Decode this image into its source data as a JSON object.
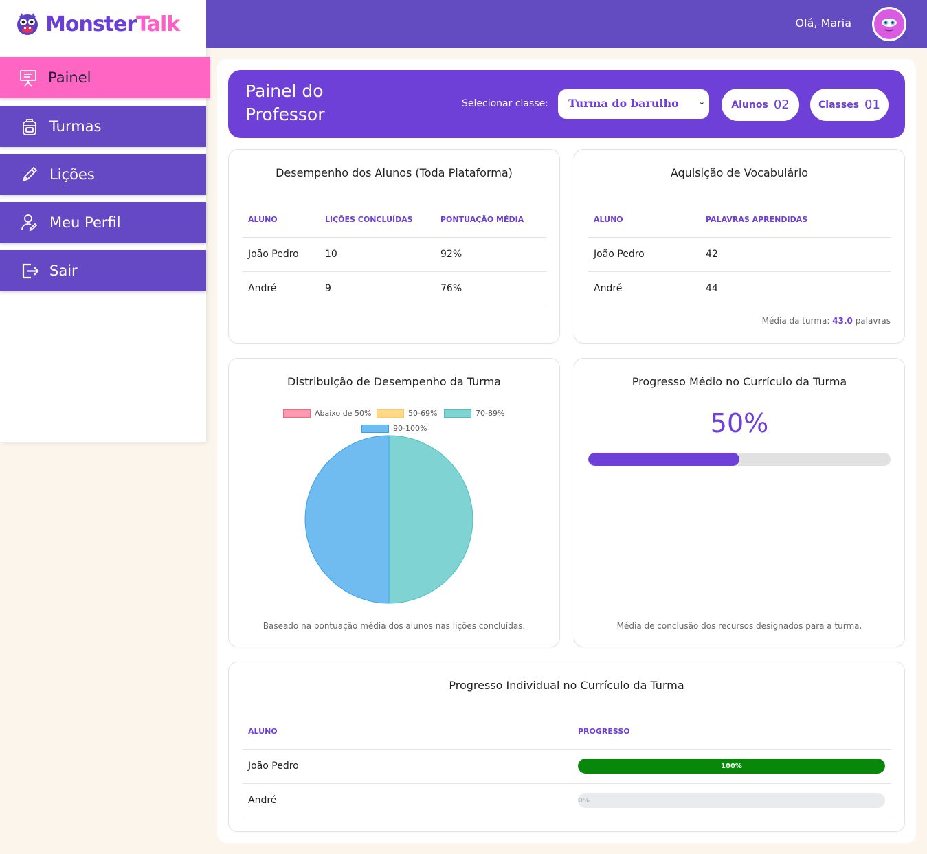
{
  "brand": {
    "part1": "Monster",
    "part2": "Talk"
  },
  "sidebar": {
    "items": [
      {
        "label": "Painel",
        "icon": "presentation-icon",
        "active": true
      },
      {
        "label": "Turmas",
        "icon": "backpack-icon",
        "active": false
      },
      {
        "label": "Lições",
        "icon": "pencil-icon",
        "active": false
      },
      {
        "label": "Meu Perfil",
        "icon": "user-edit-icon",
        "active": false
      },
      {
        "label": "Sair",
        "icon": "logout-icon",
        "active": false
      }
    ]
  },
  "topbar": {
    "greeting": "Olá, Maria",
    "avatar_icon": "monster-avatar-icon"
  },
  "header": {
    "title": "Painel do Professor",
    "select_label": "Selecionar classe:",
    "selected_class": "Turma do barulho",
    "students_label": "Alunos",
    "students_count": "02",
    "classes_label": "Classes",
    "classes_count": "01"
  },
  "performance": {
    "title": "Desempenho dos Alunos (Toda Plataforma)",
    "columns": [
      "ALUNO",
      "LIÇÕES CONCLUÍDAS",
      "PONTUAÇÃO MÉDIA"
    ],
    "rows": [
      [
        "João Pedro",
        "10",
        "92%"
      ],
      [
        "André",
        "9",
        "76%"
      ]
    ]
  },
  "vocabulary": {
    "title": "Aquisição de Vocabulário",
    "columns": [
      "ALUNO",
      "PALAVRAS APRENDIDAS"
    ],
    "rows": [
      [
        "João Pedro",
        "42"
      ],
      [
        "André",
        "44"
      ]
    ],
    "avg_prefix": "Média da turma:",
    "avg_value": "43.0",
    "avg_suffix": "palavras"
  },
  "distribution": {
    "title": "Distribuição de Desempenho da Turma",
    "note": "Baseado na pontuação média dos alunos nas lições concluídas."
  },
  "chart_data": {
    "type": "pie",
    "categories": [
      "Abaixo de 50%",
      "50-69%",
      "70-89%",
      "90-100%"
    ],
    "values": [
      0,
      0,
      1,
      1
    ],
    "colors": [
      "#ff9ab0",
      "#ffd98a",
      "#7fd3d3",
      "#70bcf0"
    ],
    "border_colors": [
      "#ff6384",
      "#ffcd56",
      "#4bc0c0",
      "#36a2eb"
    ],
    "legend_position": "top"
  },
  "curriculum": {
    "title": "Progresso Médio no Currículo da Turma",
    "percent_text": "50%",
    "progress": 0.5,
    "note": "Média de conclusão dos recursos designados para a turma."
  },
  "individual": {
    "title": "Progresso Individual no Currículo da Turma",
    "columns": [
      "ALUNO",
      "PROGRESSO"
    ],
    "rows": [
      {
        "name": "João Pedro",
        "progress": 1.0,
        "label": "100%"
      },
      {
        "name": "André",
        "progress": 0.0,
        "label": "0%"
      }
    ]
  },
  "colors": {
    "accent": "#6e40d8",
    "topbar": "#634bc2",
    "active_nav": "#ff66c4",
    "progress_green": "#08870a"
  }
}
